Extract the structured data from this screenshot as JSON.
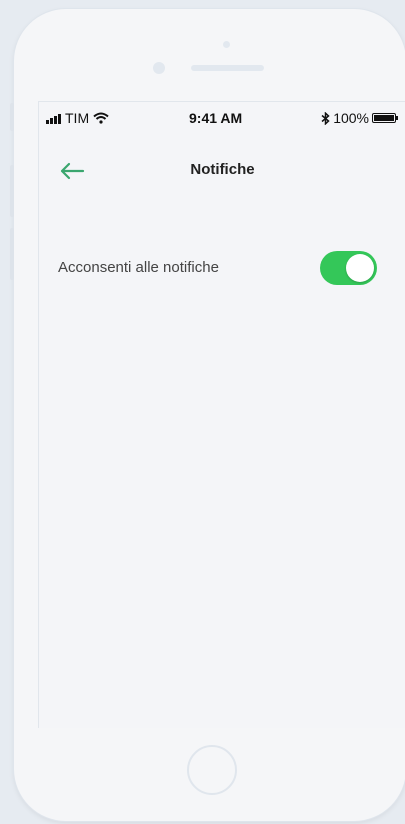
{
  "status_bar": {
    "carrier": "TIM",
    "time": "9:41 AM",
    "battery": "100%"
  },
  "header": {
    "title": "Notifiche"
  },
  "settings": {
    "notifications_label": "Acconsenti alle notifiche",
    "notifications_enabled": true
  },
  "colors": {
    "accent_green": "#3aa66f",
    "toggle_on": "#34c759"
  },
  "icons": {
    "back": "arrow-left-icon",
    "bluetooth": "bluetooth-icon",
    "wifi": "wifi-icon"
  }
}
